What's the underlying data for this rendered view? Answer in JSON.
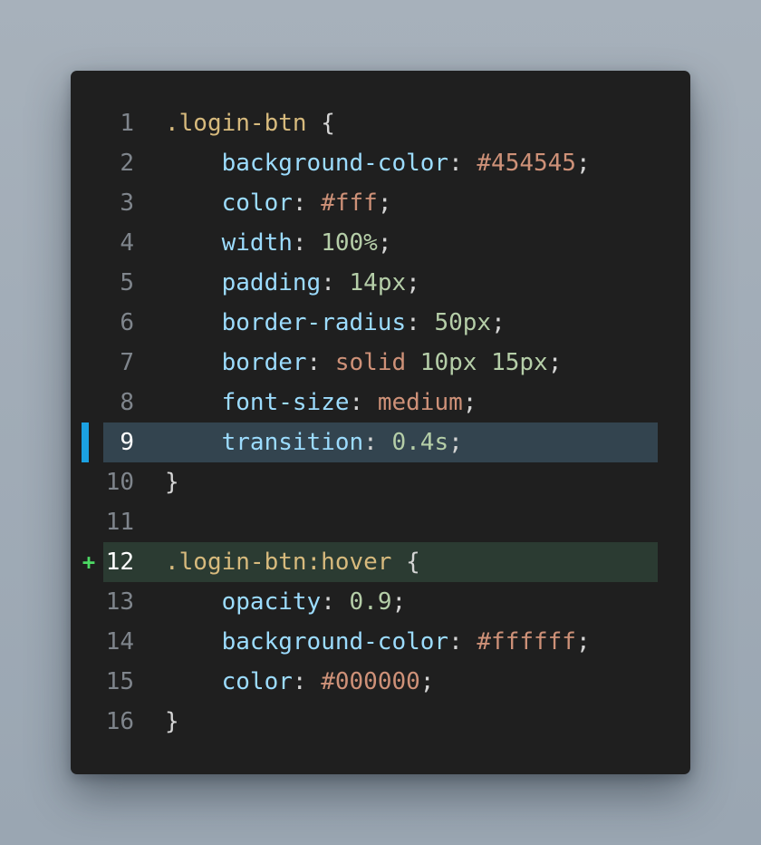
{
  "editor": {
    "language": "css",
    "active_line": 9,
    "added_line": 12,
    "colors": {
      "background": "#1f1f1f",
      "active_line_bg": "#33444f",
      "added_line_bg": "#2b3b32",
      "gutter_indicator": "#1ba1e2",
      "added_marker": "#4cd964"
    },
    "added_marker": "+",
    "lines": [
      {
        "number": "1",
        "tokens": [
          {
            "t": "selector",
            "v": ".login-btn"
          },
          {
            "t": "punct",
            "v": " {"
          }
        ]
      },
      {
        "number": "2",
        "tokens": [
          {
            "t": "indent",
            "v": "    "
          },
          {
            "t": "property",
            "v": "background-color"
          },
          {
            "t": "punct",
            "v": ": "
          },
          {
            "t": "string",
            "v": "#454545"
          },
          {
            "t": "punct",
            "v": ";"
          }
        ]
      },
      {
        "number": "3",
        "tokens": [
          {
            "t": "indent",
            "v": "    "
          },
          {
            "t": "property",
            "v": "color"
          },
          {
            "t": "punct",
            "v": ": "
          },
          {
            "t": "string",
            "v": "#fff"
          },
          {
            "t": "punct",
            "v": ";"
          }
        ]
      },
      {
        "number": "4",
        "tokens": [
          {
            "t": "indent",
            "v": "    "
          },
          {
            "t": "property",
            "v": "width"
          },
          {
            "t": "punct",
            "v": ": "
          },
          {
            "t": "number",
            "v": "100%"
          },
          {
            "t": "punct",
            "v": ";"
          }
        ]
      },
      {
        "number": "5",
        "tokens": [
          {
            "t": "indent",
            "v": "    "
          },
          {
            "t": "property",
            "v": "padding"
          },
          {
            "t": "punct",
            "v": ": "
          },
          {
            "t": "number",
            "v": "14px"
          },
          {
            "t": "punct",
            "v": ";"
          }
        ]
      },
      {
        "number": "6",
        "tokens": [
          {
            "t": "indent",
            "v": "    "
          },
          {
            "t": "property",
            "v": "border-radius"
          },
          {
            "t": "punct",
            "v": ": "
          },
          {
            "t": "number",
            "v": "50px"
          },
          {
            "t": "punct",
            "v": ";"
          }
        ]
      },
      {
        "number": "7",
        "tokens": [
          {
            "t": "indent",
            "v": "    "
          },
          {
            "t": "property",
            "v": "border"
          },
          {
            "t": "punct",
            "v": ": "
          },
          {
            "t": "string",
            "v": "solid"
          },
          {
            "t": "punct",
            "v": " "
          },
          {
            "t": "number",
            "v": "10px"
          },
          {
            "t": "punct",
            "v": " "
          },
          {
            "t": "number",
            "v": "15px"
          },
          {
            "t": "punct",
            "v": ";"
          }
        ]
      },
      {
        "number": "8",
        "tokens": [
          {
            "t": "indent",
            "v": "    "
          },
          {
            "t": "property",
            "v": "font-size"
          },
          {
            "t": "punct",
            "v": ": "
          },
          {
            "t": "string",
            "v": "medium"
          },
          {
            "t": "punct",
            "v": ";"
          }
        ]
      },
      {
        "number": "9",
        "tokens": [
          {
            "t": "indent",
            "v": "    "
          },
          {
            "t": "property",
            "v": "transition"
          },
          {
            "t": "punct",
            "v": ": "
          },
          {
            "t": "number",
            "v": "0.4s"
          },
          {
            "t": "punct",
            "v": ";"
          }
        ]
      },
      {
        "number": "10",
        "tokens": [
          {
            "t": "punct",
            "v": "}"
          }
        ]
      },
      {
        "number": "11",
        "tokens": []
      },
      {
        "number": "12",
        "tokens": [
          {
            "t": "selector",
            "v": ".login-btn:hover"
          },
          {
            "t": "punct",
            "v": " {"
          }
        ]
      },
      {
        "number": "13",
        "tokens": [
          {
            "t": "indent",
            "v": "    "
          },
          {
            "t": "property",
            "v": "opacity"
          },
          {
            "t": "punct",
            "v": ": "
          },
          {
            "t": "number",
            "v": "0.9"
          },
          {
            "t": "punct",
            "v": ";"
          }
        ]
      },
      {
        "number": "14",
        "tokens": [
          {
            "t": "indent",
            "v": "    "
          },
          {
            "t": "property",
            "v": "background-color"
          },
          {
            "t": "punct",
            "v": ": "
          },
          {
            "t": "string",
            "v": "#ffffff"
          },
          {
            "t": "punct",
            "v": ";"
          }
        ]
      },
      {
        "number": "15",
        "tokens": [
          {
            "t": "indent",
            "v": "    "
          },
          {
            "t": "property",
            "v": "color"
          },
          {
            "t": "punct",
            "v": ": "
          },
          {
            "t": "string",
            "v": "#000000"
          },
          {
            "t": "punct",
            "v": ";"
          }
        ]
      },
      {
        "number": "16",
        "tokens": [
          {
            "t": "punct",
            "v": "}"
          }
        ]
      }
    ]
  }
}
